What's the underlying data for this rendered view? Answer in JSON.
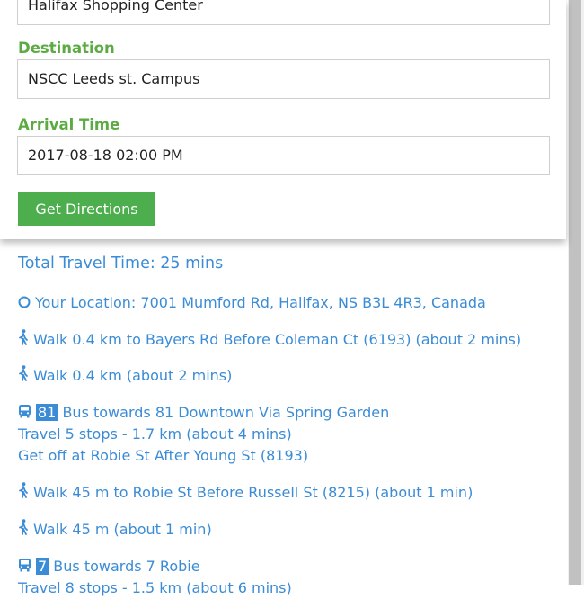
{
  "form": {
    "origin_value": "Halifax Shopping Center",
    "destination_label": "Destination",
    "destination_value": "NSCC Leeds st. Campus",
    "arrival_label": "Arrival Time",
    "arrival_value": "2017-08-18 02:00 PM",
    "button_label": "Get Directions"
  },
  "results": {
    "total_travel_time": "Total Travel Time: 25 mins",
    "steps": [
      {
        "icon": "location-circle-icon",
        "text": "Your Location: 7001 Mumford Rd, Halifax, NS B3L 4R3, Canada"
      },
      {
        "icon": "walk-icon",
        "text": "Walk 0.4 km to Bayers Rd Before Coleman Ct (6193) (about 2 mins)"
      },
      {
        "icon": "walk-icon",
        "text": "Walk 0.4 km (about 2 mins)"
      },
      {
        "icon": "bus-icon",
        "route": "81",
        "text": "Bus towards 81 Downtown Via Spring Garden",
        "details": [
          "Travel 5 stops - 1.7 km (about 4 mins)",
          "Get off at Robie St After Young St (8193)"
        ]
      },
      {
        "icon": "walk-icon",
        "text": "Walk 45 m to Robie St Before Russell St (8215) (about 1 min)"
      },
      {
        "icon": "walk-icon",
        "text": "Walk 45 m (about 1 min)"
      },
      {
        "icon": "bus-icon",
        "route": "7",
        "text": "Bus towards 7 Robie",
        "details": [
          "Travel 8 stops - 1.5 km (about 6 mins)"
        ]
      }
    ]
  },
  "colors": {
    "label_green": "#5cab42",
    "button_green": "#4cae4c",
    "link_blue": "#3b8cd6"
  }
}
